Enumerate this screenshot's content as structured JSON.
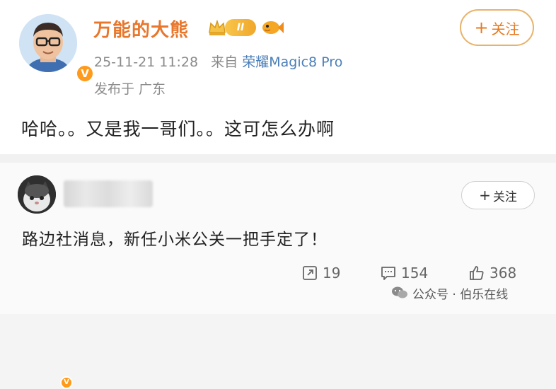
{
  "post": {
    "username": "万能的大熊",
    "level_label": "II",
    "timestamp": "25-11-21 11:28",
    "source_prefix": "来自",
    "source_device": "荣耀Magic8 Pro",
    "location": "发布于 广东",
    "follow_label": "关注",
    "text": "哈哈。。又是我一哥们。。这可怎么办啊"
  },
  "comment": {
    "follow_label": "关注",
    "text": "路边社消息，新任小米公关一把手定了！",
    "repost_count": "19",
    "comment_count": "154",
    "like_count": "368"
  },
  "watermark": {
    "text": "公众号 · 伯乐在线"
  },
  "icons": {
    "verified": "v-badge-icon",
    "crown": "crown-icon",
    "fish": "fish-icon",
    "repost": "repost-icon",
    "comment": "comment-icon",
    "like": "thumbs-up-icon",
    "wechat": "wechat-icon"
  },
  "colors": {
    "username": "#e8762b",
    "device_link": "#4b7fb8",
    "verified": "#ff9a1a",
    "follow_border": "#e8b26a"
  }
}
